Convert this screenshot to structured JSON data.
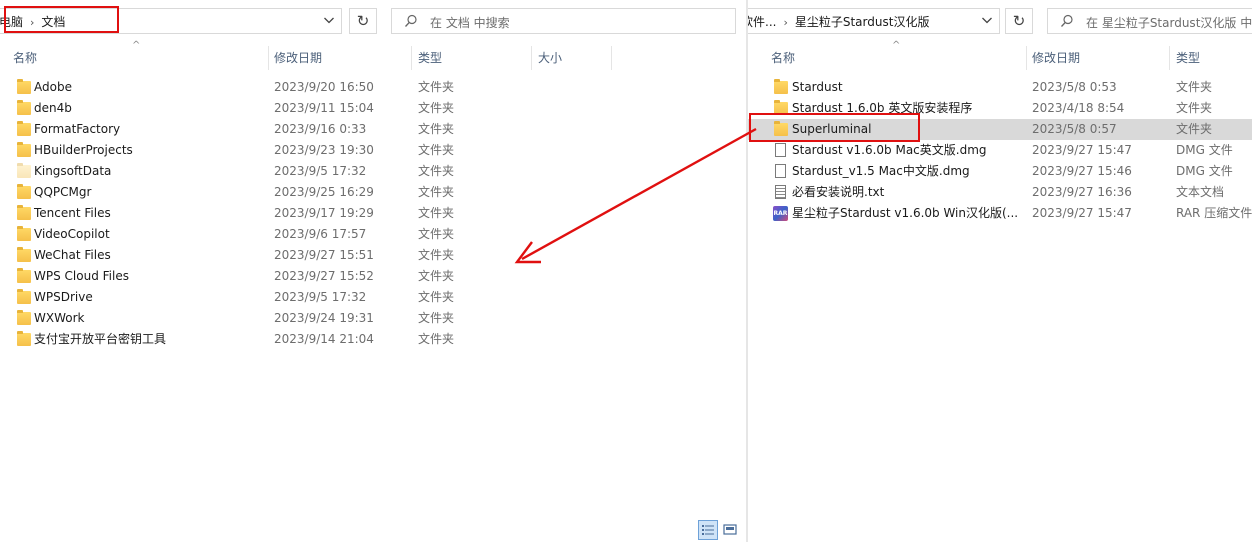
{
  "left": {
    "breadcrumb": [
      "电脑",
      "文档"
    ],
    "search_placeholder": "在 文档 中搜索",
    "columns": {
      "name": "名称",
      "date": "修改日期",
      "type": "类型",
      "size": "大小"
    },
    "rows": [
      {
        "name": "Adobe",
        "date": "2023/9/20 16:50",
        "type": "文件夹",
        "icon": "folder-icon"
      },
      {
        "name": "den4b",
        "date": "2023/9/11 15:04",
        "type": "文件夹",
        "icon": "folder-icon"
      },
      {
        "name": "FormatFactory",
        "date": "2023/9/16 0:33",
        "type": "文件夹",
        "icon": "folder-icon"
      },
      {
        "name": "HBuilderProjects",
        "date": "2023/9/23 19:30",
        "type": "文件夹",
        "icon": "folder-icon"
      },
      {
        "name": "KingsoftData",
        "date": "2023/9/5 17:32",
        "type": "文件夹",
        "icon": "folder-pale-icon"
      },
      {
        "name": "QQPCMgr",
        "date": "2023/9/25 16:29",
        "type": "文件夹",
        "icon": "folder-icon"
      },
      {
        "name": "Tencent Files",
        "date": "2023/9/17 19:29",
        "type": "文件夹",
        "icon": "folder-icon"
      },
      {
        "name": "VideoCopilot",
        "date": "2023/9/6 17:57",
        "type": "文件夹",
        "icon": "folder-icon"
      },
      {
        "name": "WeChat Files",
        "date": "2023/9/27 15:51",
        "type": "文件夹",
        "icon": "folder-icon"
      },
      {
        "name": "WPS Cloud Files",
        "date": "2023/9/27 15:52",
        "type": "文件夹",
        "icon": "folder-icon"
      },
      {
        "name": "WPSDrive",
        "date": "2023/9/5 17:32",
        "type": "文件夹",
        "icon": "folder-icon"
      },
      {
        "name": "WXWork",
        "date": "2023/9/24 19:31",
        "type": "文件夹",
        "icon": "folder-icon"
      },
      {
        "name": "支付宝开放平台密钥工具",
        "date": "2023/9/14 21:04",
        "type": "文件夹",
        "icon": "folder-icon"
      }
    ]
  },
  "right": {
    "breadcrumb": [
      "软件...",
      "星尘粒子Stardust汉化版"
    ],
    "search_placeholder": "在 星尘粒子Stardust汉化版 中",
    "columns": {
      "name": "名称",
      "date": "修改日期",
      "type": "类型"
    },
    "rows": [
      {
        "name": "Stardust",
        "date": "2023/5/8 0:53",
        "type": "文件夹",
        "icon": "folder-icon"
      },
      {
        "name": "Stardust 1.6.0b 英文版安装程序",
        "date": "2023/4/18 8:54",
        "type": "文件夹",
        "icon": "folder-icon"
      },
      {
        "name": "Superluminal",
        "date": "2023/5/8 0:57",
        "type": "文件夹",
        "icon": "folder-icon",
        "selected": true
      },
      {
        "name": "Stardust v1.6.0b Mac英文版.dmg",
        "date": "2023/9/27 15:47",
        "type": "DMG 文件",
        "icon": "file-icon"
      },
      {
        "name": "Stardust_v1.5 Mac中文版.dmg",
        "date": "2023/9/27 15:46",
        "type": "DMG 文件",
        "icon": "file-icon"
      },
      {
        "name": "必看安装说明.txt",
        "date": "2023/9/27 16:36",
        "type": "文本文档",
        "icon": "text-file-icon"
      },
      {
        "name": "星尘粒子Stardust v1.6.0b Win汉化版(...",
        "date": "2023/9/27 15:47",
        "type": "RAR 压缩文件",
        "icon": "rar-icon"
      }
    ]
  },
  "annotation_color": "#e01010",
  "selection_color": "#d9d9d9",
  "icons": {
    "dropdown": "chevron-down-icon",
    "refresh": "refresh-icon",
    "search": "search-icon",
    "sort": "sort-up-icon",
    "view_details": "details-view-icon",
    "view_tiles": "large-icons-view-icon"
  }
}
